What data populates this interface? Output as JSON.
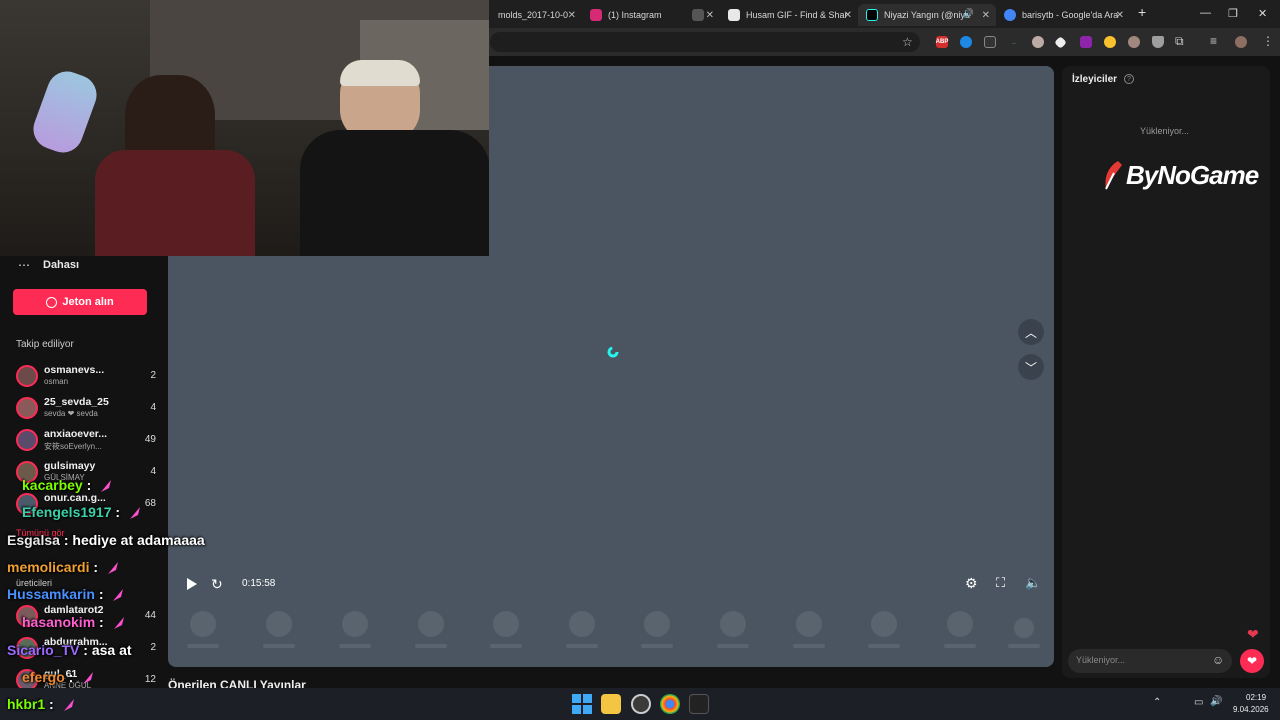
{
  "browser": {
    "tabs": [
      {
        "title": "molds_2017-10-0",
        "icon_color": "#7a7a7a"
      },
      {
        "title": "(1) Instagram",
        "icon_color": "#d62976"
      },
      {
        "title": "",
        "icon_color": "#555555"
      },
      {
        "title": "Husam GIF - Find & Shar",
        "icon_color": "#e8e8e8"
      },
      {
        "title": "Niyazi Yangın (@niya",
        "icon_color": "#000000"
      },
      {
        "title": "barisytb - Google'da Ara",
        "icon_color": "#4285f4"
      }
    ],
    "new_tab_label": "+",
    "window_controls": [
      "—",
      "❐",
      "✕"
    ]
  },
  "sidebar": {
    "more_label": "Dahası",
    "coins_button_label": "Jeton alın",
    "following_title": "Takip ediliyor",
    "following": [
      {
        "name": "osmanevs...",
        "sub": "osman",
        "count": "2"
      },
      {
        "name": "25_sevda_25",
        "sub": "sevda ❤ sevda",
        "count": "4"
      },
      {
        "name": "anxiaoever...",
        "sub": "安筱soEverlyn...",
        "count": "49"
      },
      {
        "name": "gulsimayy",
        "sub": "GÜLSİMAY",
        "count": "4"
      },
      {
        "name": "onur.can.g...",
        "sub": "",
        "count": "68"
      }
    ],
    "see_all_label": "Tümünü gör",
    "creators_title": "üreticileri",
    "creators": [
      {
        "name": "damlatarot2",
        "sub": "",
        "count": "44"
      },
      {
        "name": "abdurrahm...",
        "sub": "",
        "count": "2"
      },
      {
        "name": "gul_61",
        "sub": "ANNE OĞUL",
        "count": "12"
      }
    ]
  },
  "chat_overlay": [
    {
      "user": "kacarbey",
      "msg": "",
      "color": "#7CFC00"
    },
    {
      "user": "Efengels1917",
      "msg": "",
      "color": "#3ad1a8"
    },
    {
      "user": "Esgalsa",
      "msg": "hediye at adamaaaa",
      "color": "#e8e8e8"
    },
    {
      "user": "memolicardi",
      "msg": "",
      "color": "#f0a030"
    },
    {
      "user": "Hussamkarin",
      "msg": "",
      "color": "#4a90ff"
    },
    {
      "user": "hasanokim",
      "msg": "",
      "color": "#ff5fd0"
    },
    {
      "user": "Sicario_TV",
      "msg": "asa at",
      "color": "#9b6bff"
    },
    {
      "user": "efergo",
      "msg": "",
      "color": "#f08a30"
    },
    {
      "user": "hkbr1",
      "msg": "",
      "color": "#7CFC00"
    }
  ],
  "player": {
    "time": "0:15:58"
  },
  "below_player": {
    "title": "Önerilen CANLI Yayınlar"
  },
  "right_panel": {
    "title": "İzleyiciler",
    "loading": "Yükleniyor...",
    "brand_logo": "ByNoGame",
    "comment_placeholder": "Yükleniyor..."
  },
  "taskbar": {
    "time": "02:19",
    "date": "9.04.2026"
  },
  "colors": {
    "accent": "#fe2c55",
    "player_bg": "#4b5561",
    "loader": "#25f4ee"
  }
}
